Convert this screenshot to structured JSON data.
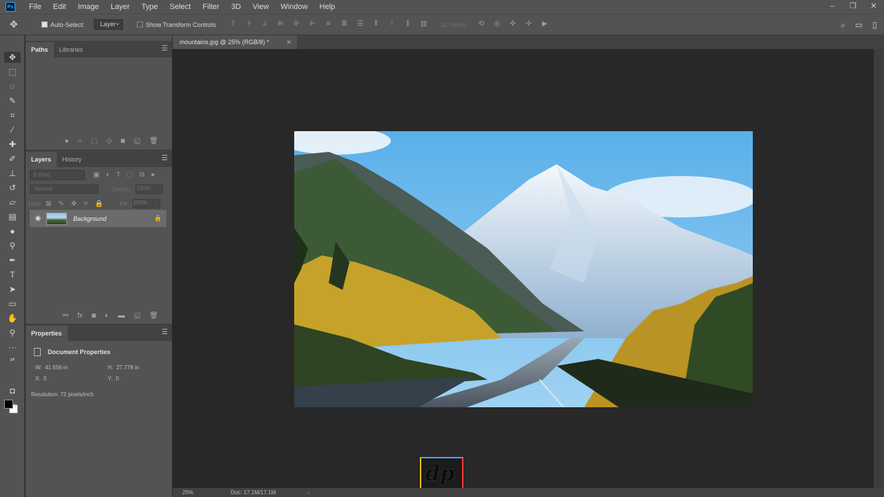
{
  "app": {
    "logo": "Ps"
  },
  "menu": [
    "File",
    "Edit",
    "Image",
    "Layer",
    "Type",
    "Select",
    "Filter",
    "3D",
    "View",
    "Window",
    "Help"
  ],
  "options": {
    "auto_select_label": "Auto-Select:",
    "auto_select_value": "Layer",
    "transform_label": "Show Transform Controls",
    "mode_3d_label": "3D Mode:"
  },
  "paths_panel": {
    "tabs": [
      "Paths",
      "Libraries"
    ]
  },
  "layers_panel": {
    "tabs": [
      "Layers",
      "History"
    ],
    "kind_placeholder": "Kind",
    "blend_mode": "Normal",
    "opacity_label": "Opacity:",
    "opacity_value": "100%",
    "lock_label": "Lock:",
    "fill_label": "Fill:",
    "fill_value": "100%",
    "layer": {
      "name": "Background"
    }
  },
  "properties_panel": {
    "tab": "Properties",
    "header": "Document Properties",
    "w_label": "W:",
    "w_value": "41.556 in",
    "h_label": "H:",
    "h_value": "27.778 in",
    "x_label": "X:",
    "x_value": "0",
    "y_label": "Y:",
    "y_value": "0",
    "resolution": "Resolution: 72 pixels/inch"
  },
  "document": {
    "tab_title": "mountains.jpg @ 25% (RGB/8) *",
    "zoom": "25%",
    "doc_size": "Doc: 17.1M/17.1M"
  },
  "watermark": {
    "text": "dp"
  }
}
